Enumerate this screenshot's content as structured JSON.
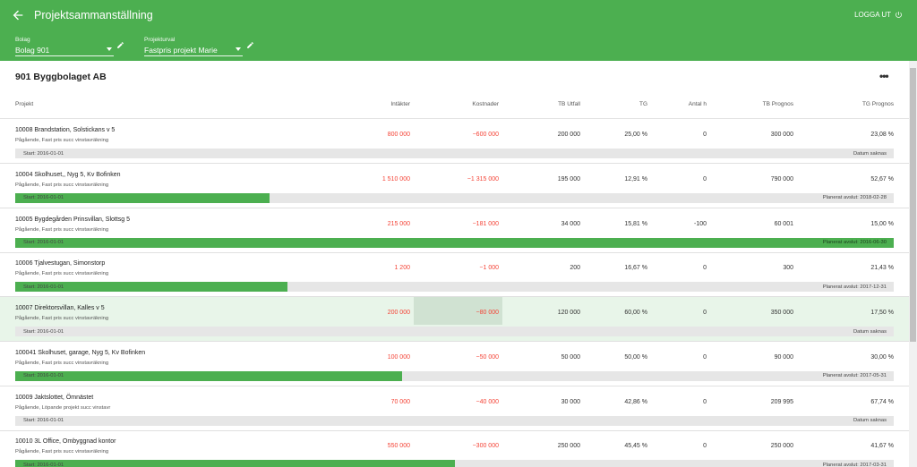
{
  "app": {
    "title": "Projektsammanställning",
    "logout": "LOGGA UT"
  },
  "filters": {
    "company_label": "Bolag",
    "company_value": "Bolag 901",
    "selection_label": "Projekturval",
    "selection_value": "Fastpris projekt Marie"
  },
  "company_name": "901 Byggbolaget AB",
  "columns": [
    "Projekt",
    "Intäkter",
    "Kostnader",
    "TB Utfall",
    "TG",
    "Antal h",
    "TB Prognos",
    "TG Prognos"
  ],
  "rows": [
    {
      "name": "10008 Brandstation, Solstickans v 5",
      "desc": "Pågående, Fast pris succ vinstavräkning",
      "intakter": "800 000",
      "kostnader": "−600 000",
      "tb_utfall": "200 000",
      "tg": "25,00 %",
      "antal_h": "0",
      "tb_prognos": "300 000",
      "tg_prognos": "23,08 %",
      "start": "Start: 2016-01-01",
      "end": "Datum saknas",
      "progress": 0
    },
    {
      "name": "10004 Skolhuset,, Nyg 5, Kv Bofinken",
      "desc": "Pågående, Fast pris succ vinstavräkning",
      "intakter": "1 510 000",
      "kostnader": "−1 315 000",
      "tb_utfall": "195 000",
      "tg": "12,91 %",
      "antal_h": "0",
      "tb_prognos": "790 000",
      "tg_prognos": "52,67 %",
      "start": "Start: 2016-01-01",
      "end": "Planerat avslut: 2018-02-28",
      "progress": 0.29
    },
    {
      "name": "10005 Bygdegården Prinsvillan, Slottsg 5",
      "desc": "Pågående, Fast pris succ vinstavräkning",
      "intakter": "215 000",
      "kostnader": "−181 000",
      "tb_utfall": "34 000",
      "tg": "15,81 %",
      "antal_h": "-100",
      "tb_prognos": "60 001",
      "tg_prognos": "15,00 %",
      "start": "Start: 2016-01-01",
      "end": "Planerat avslut: 2016-06-30",
      "progress": 1.0
    },
    {
      "name": "10006 Tjalvestugan, Simonstorp",
      "desc": "Pågående, Fast pris succ vinstavräkning",
      "intakter": "1 200",
      "kostnader": "−1 000",
      "tb_utfall": "200",
      "tg": "16,67 %",
      "antal_h": "0",
      "tb_prognos": "300",
      "tg_prognos": "21,43 %",
      "start": "Start: 2016-01-01",
      "end": "Planerat avslut: 2017-12-31",
      "progress": 0.31
    },
    {
      "name": "10007 Direktorsvillan, Kalles v 5",
      "desc": "Pågående, Fast pris succ vinstavräkning",
      "intakter": "200 000",
      "kostnader": "−80 000",
      "tb_utfall": "120 000",
      "tg": "60,00 %",
      "antal_h": "0",
      "tb_prognos": "350 000",
      "tg_prognos": "17,50 %",
      "start": "Start: 2016-01-01",
      "end": "Datum saknas",
      "progress": 0
    },
    {
      "name": "100041 Skolhuset, garage, Nyg 5, Kv Bofinken",
      "desc": "Pågående, Fast pris succ vinstavräkning",
      "intakter": "100 000",
      "kostnader": "−50 000",
      "tb_utfall": "50 000",
      "tg": "50,00 %",
      "antal_h": "0",
      "tb_prognos": "90 000",
      "tg_prognos": "30,00 %",
      "start": "Start: 2016-01-01",
      "end": "Planerat avslut: 2017-05-31",
      "progress": 0.44
    },
    {
      "name": "10009 Jaktslottet, Ömnästet",
      "desc": "Pågående, Löpande projekt succ vinstavr",
      "intakter": "70 000",
      "kostnader": "−40 000",
      "tb_utfall": "30 000",
      "tg": "42,86 %",
      "antal_h": "0",
      "tb_prognos": "209 995",
      "tg_prognos": "67,74 %",
      "start": "Start: 2016-01-01",
      "end": "Datum saknas",
      "progress": 0
    },
    {
      "name": "10010 3L Office, Ombyggnad kontor",
      "desc": "Pågående, Fast pris succ vinstavräkning",
      "intakter": "550 000",
      "kostnader": "−300 000",
      "tb_utfall": "250 000",
      "tg": "45,45 %",
      "antal_h": "0",
      "tb_prognos": "250 000",
      "tg_prognos": "41,67 %",
      "start": "Start: 2016-01-01",
      "end": "Planerat avslut: 2017-03-31",
      "progress": 0.5
    }
  ],
  "colors": {
    "primary": "#4caf50",
    "negative": "#f44336",
    "highlight": "#e8f5e9"
  },
  "icons": {
    "back": "arrow-left-icon",
    "logout": "power-icon",
    "edit": "pencil-icon",
    "more": "more-horizontal-icon"
  }
}
